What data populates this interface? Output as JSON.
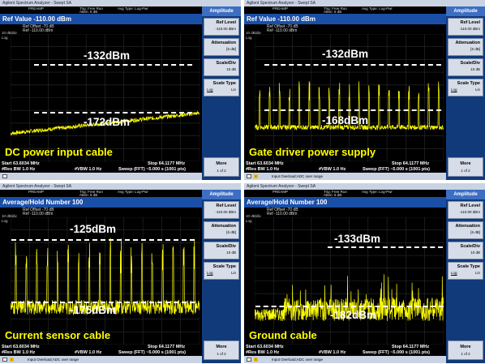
{
  "colors": {
    "trace": "#ffff00",
    "annotation": "#ffffff",
    "caption": "#ffff00",
    "softkey_header": "#3c6ec2",
    "header_bar": "#1a4fa8"
  },
  "panels": [
    {
      "title": "Agilent Spectrum Analyzer - Swept SA",
      "header": "Ref Value -110.00 dBm",
      "status_items": [
        "PREAMP",
        "Trig: Free Run",
        "Avg Type: Log-Pwr",
        "Atten: 6 dB"
      ],
      "ref_offset": "Ref Offset -70 dB",
      "ref_level": "Ref -110.00 dBm",
      "scale_label": "10 dB/div",
      "log_label": "Log",
      "upper_annotation": "-132dBm",
      "lower_annotation": "-172dBm",
      "caption": "DC power input cable",
      "start": "Start 63.6034 MHz",
      "stop": "Stop 64.1177 MHz",
      "rbw": "#Res BW 1.0 Hz",
      "vbw": "#VBW 1.0 Hz",
      "sweep": "Sweep (FFT) ~5.000 s (1001 pts)",
      "message": "",
      "softkeys": {
        "header": "Amplitude",
        "ref_level_label": "Ref Level",
        "ref_level_value": "-110.00 dBm",
        "atten_label": "Attenuation",
        "atten_value": "[6 dB]",
        "scale_label": "Scale/Div",
        "scale_value": "10 dB",
        "type_label": "Scale Type",
        "type_log": "Log",
        "type_lin": "Lin",
        "more_label": "More",
        "more_page": "1 of 2"
      }
    },
    {
      "title": "Agilent Spectrum Analyzer - Swept SA",
      "header": "Ref Value -110.00 dBm",
      "status_items": [
        "PREAMP",
        "Trig: Free Run",
        "Avg Type: Log-Pwr",
        "Atten: 6 dB"
      ],
      "ref_offset": "Ref Offset -70 dB",
      "ref_level": "Ref -110.00 dBm",
      "scale_label": "10 dB/div",
      "log_label": "Log",
      "upper_annotation": "-132dBm",
      "lower_annotation": "-168dBm",
      "caption": "Gate driver power supply",
      "start": "Start 63.6034 MHz",
      "stop": "Stop 64.1177 MHz",
      "rbw": "#Res BW 1.0 Hz",
      "vbw": "#VBW 1.0 Hz",
      "sweep": "Sweep (FFT) ~5.000 s (1001 pts)",
      "message": "Input Overload;ADC over range",
      "softkeys": {
        "header": "Amplitude",
        "ref_level_label": "Ref Level",
        "ref_level_value": "-110.00 dBm",
        "atten_label": "Attenuation",
        "atten_value": "[6 dB]",
        "scale_label": "Scale/Div",
        "scale_value": "10 dB",
        "type_label": "Scale Type",
        "type_log": "Log",
        "type_lin": "Lin",
        "more_label": "More",
        "more_page": "1 of 2"
      }
    },
    {
      "title": "Agilent Spectrum Analyzer - Swept SA",
      "header": "Average/Hold Number 100",
      "status_items": [
        "PREAMP",
        "Trig: Free Run",
        "Avg Type: Log-Pwr",
        "Atten: 6 dB"
      ],
      "ref_offset": "Ref Offset -70 dB",
      "ref_level": "Ref -110.00 dBm",
      "scale_label": "10 dB/div",
      "log_label": "Log",
      "upper_annotation": "-125dBm",
      "lower_annotation": "-175dBm",
      "caption": "Current sensor cable",
      "start": "Start 63.6034 MHz",
      "stop": "Stop 64.1177 MHz",
      "rbw": "#Res BW 1.0 Hz",
      "vbw": "#VBW 1.0 Hz",
      "sweep": "Sweep (FFT) ~5.000 s (1001 pts)",
      "message": "Input Overload;ADC over range",
      "softkeys": {
        "header": "Amplitude",
        "ref_level_label": "Ref Level",
        "ref_level_value": "-110.00 dBm",
        "atten_label": "Attenuation",
        "atten_value": "[6 dB]",
        "scale_label": "Scale/Div",
        "scale_value": "10 dB",
        "type_label": "Scale Type",
        "type_log": "Log",
        "type_lin": "Lin",
        "more_label": "More",
        "more_page": "1 of 2"
      }
    },
    {
      "title": "Agilent Spectrum Analyzer - Swept SA",
      "header": "Average/Hold Number 100",
      "status_items": [
        "PREAMP",
        "Trig: Free Run",
        "Avg Type: Log-Pwr",
        "Atten: 6 dB"
      ],
      "ref_offset": "Ref Offset -70 dB",
      "ref_level": "Ref -110.00 dBm",
      "scale_label": "10 dB/div",
      "log_label": "Log",
      "upper_annotation": "-133dBm",
      "lower_annotation": "-182dBm",
      "caption": "Ground cable",
      "start": "Start 63.6034 MHz",
      "stop": "Stop 64.1177 MHz",
      "rbw": "#Res BW 1.0 Hz",
      "vbw": "#VBW 1.0 Hz",
      "sweep": "Sweep (FFT) ~5.000 s (1001 pts)",
      "message": "Input Overload;ADC over range",
      "softkeys": {
        "header": "Amplitude",
        "ref_level_label": "Ref Level",
        "ref_level_value": "-110.00 dBm",
        "atten_label": "Attenuation",
        "atten_value": "[6 dB]",
        "scale_label": "Scale/Div",
        "scale_value": "10 dB",
        "type_label": "Scale Type",
        "type_log": "Log",
        "type_lin": "Lin",
        "more_label": "More",
        "more_page": "1 of 2"
      }
    }
  ]
}
